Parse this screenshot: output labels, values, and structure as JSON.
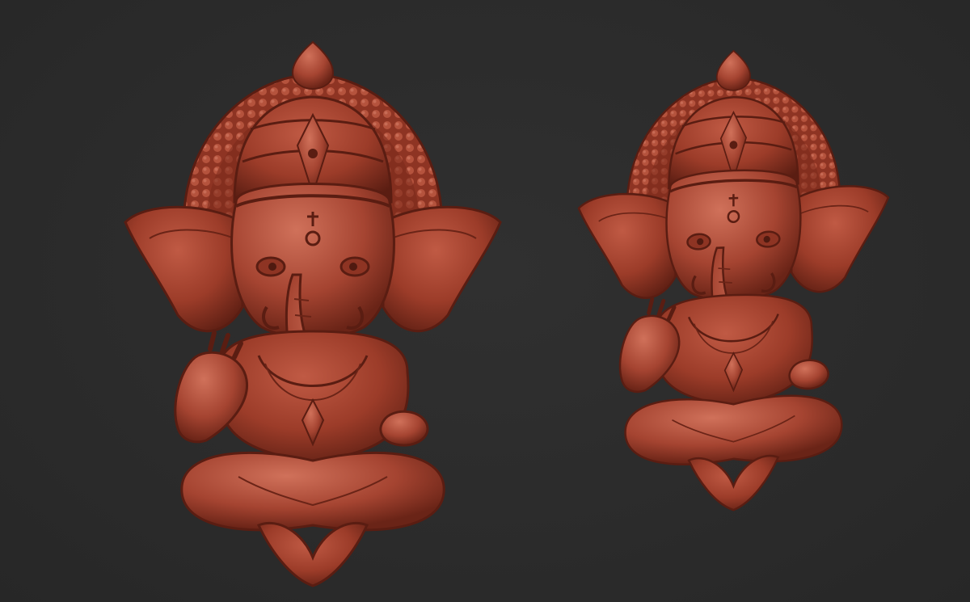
{
  "scene": {
    "background_color": "#2b2b2b",
    "material_color": "#a2402c",
    "material_shadow": "#4f1a10",
    "material_highlight": "#d2725c",
    "models": [
      {
        "id": "front",
        "subject": "ganesha-relief",
        "view": "front"
      },
      {
        "id": "angled",
        "subject": "ganesha-relief",
        "view": "three-quarter"
      }
    ]
  }
}
